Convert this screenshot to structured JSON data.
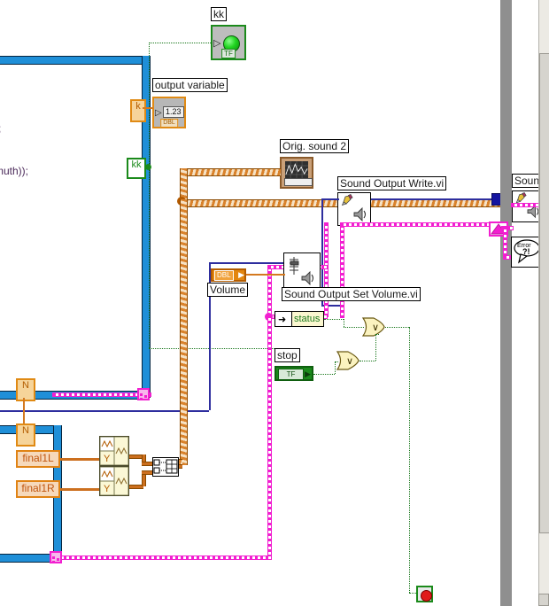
{
  "app": {
    "type": "labview-block-diagram",
    "title": "LabVIEW Block Diagram"
  },
  "code_text": {
    "fragment_1": ";",
    "fragment_2": "muth));"
  },
  "labels": {
    "kk_indicator": "kk",
    "output_variable": "output variable",
    "orig_sound_2": "Orig. sound 2",
    "sound_output_write": "Sound Output Write.vi",
    "sound_output_set_volume": "Sound Output Set Volume.vi",
    "volume": "Volume",
    "status": "status",
    "stop": "stop",
    "sound": "Sound",
    "final1L": "final1L",
    "final1R": "final1R"
  },
  "tunnels": {
    "k": "k",
    "kk": "kk",
    "n_top": "N",
    "n_bottom": "N"
  },
  "terminals": {
    "bool_tf": "TF",
    "stop_tf": "TF",
    "dbl_value": "1.23",
    "dbl_tag": "DBL",
    "volume_tag": "DBL"
  },
  "icons": {
    "led_boolean": "green-led-icon",
    "numeric_indicator": "numeric-indicator-icon",
    "waveform_graph": "waveform-graph-icon",
    "sound_write": "pencil-speaker-icon",
    "sound_volume": "slider-speaker-icon",
    "error_dialog": "error-dialog-icon",
    "build_waveform": "build-waveform-icon",
    "build_array": "build-array-icon",
    "or_gate": "or-gate-icon",
    "stop_sign": "stop-sign-icon",
    "error_tunnel": "error-tunnel-triangle-icon",
    "scrollbar": "vertical-scrollbar-icon"
  },
  "errordialog": {
    "line1": "Error",
    "line2": "?!"
  },
  "colors": {
    "loop_blue": "#1f8fd8",
    "error_magenta": "#f21fd0",
    "waveform_orange": "#d9822b",
    "boolean_green": "#17761a",
    "numeric_navy": "#2e2e9e",
    "variable_orange": "#e08314",
    "canvas_white": "#ffffff",
    "panel_gray": "#8f8f8f"
  }
}
